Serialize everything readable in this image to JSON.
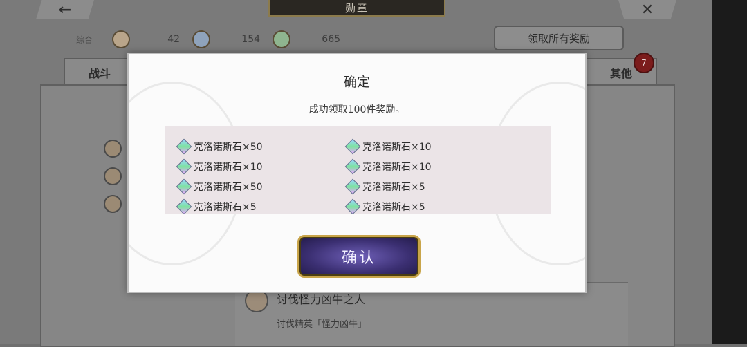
{
  "header": {
    "title": "勋章",
    "back_icon": "←",
    "close_icon": "✕"
  },
  "stats": {
    "label": "综合",
    "items": [
      {
        "value": "42",
        "color": "#b9a58a"
      },
      {
        "value": "154",
        "color": "#8fa3bb"
      },
      {
        "value": "665",
        "color": "#8fb58f"
      }
    ]
  },
  "actions": {
    "claim_all": "领取所有奖励"
  },
  "tabs": {
    "left": "战斗",
    "right": "其他",
    "badge": "7"
  },
  "background_list": {
    "quest_title": "讨伐怪力凶牛之人",
    "quest_desc": "讨伐精英「怪力凶牛」"
  },
  "modal": {
    "title": "确定",
    "message": "成功领取100件奖励。",
    "rewards": [
      "克洛诺斯石×50",
      "克洛诺斯石×10",
      "克洛诺斯石×10",
      "克洛诺斯石×10",
      "克洛诺斯石×50",
      "克洛诺斯石×5",
      "克洛诺斯石×5",
      "克洛诺斯石×5"
    ],
    "confirm": "确认"
  },
  "colors": {
    "modal_bg": "#fbfbfb",
    "reward_bg": "#ebe4e7",
    "button_gold": "#c9a54a",
    "button_purple": "#3b2f72"
  }
}
